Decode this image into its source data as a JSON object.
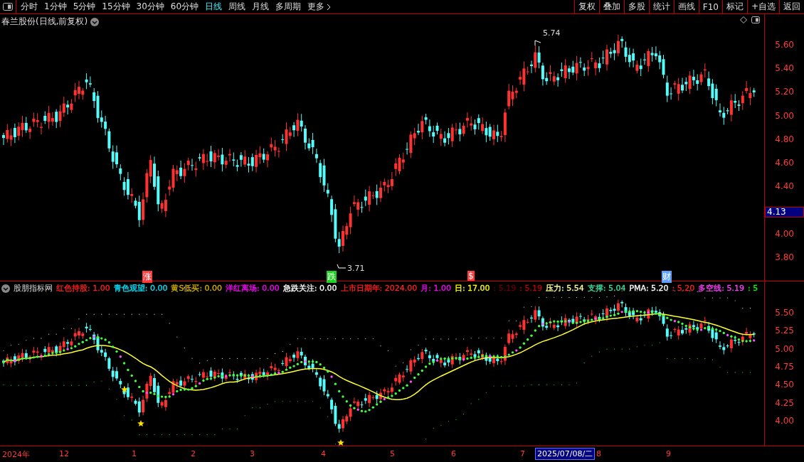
{
  "toolbar": {
    "periods": [
      {
        "label": "分时",
        "selected": false
      },
      {
        "label": "1分钟",
        "selected": false
      },
      {
        "label": "5分钟",
        "selected": false
      },
      {
        "label": "15分钟",
        "selected": false
      },
      {
        "label": "30分钟",
        "selected": false
      },
      {
        "label": "60分钟",
        "selected": false
      },
      {
        "label": "日线",
        "selected": true
      },
      {
        "label": "周线",
        "selected": false
      },
      {
        "label": "月线",
        "selected": false
      },
      {
        "label": "多周期",
        "selected": false
      },
      {
        "label": "更多",
        "selected": false
      }
    ],
    "actions": [
      "复权",
      "叠加",
      "多股",
      "统计",
      "画线",
      "F10",
      "标记",
      "+自选",
      "返回"
    ]
  },
  "main_chart": {
    "title": "春兰股份(日线,前复权)",
    "high_label": "5.74",
    "low_label": "3.71",
    "markers": [
      {
        "text": "涨",
        "color": "#ff3c3c"
      },
      {
        "text": "跌",
        "color": "#20d020"
      },
      {
        "text": "$",
        "color": "#ff3c3c"
      },
      {
        "text": "财",
        "color": "#60a0ff"
      }
    ],
    "price_ticks": [
      "5.60",
      "5.40",
      "5.20",
      "5.00",
      "4.80",
      "4.60",
      "4.40",
      "4.00",
      "3.80"
    ],
    "current_price": "4.13"
  },
  "indicator": {
    "name": "股朋指标网",
    "legend": [
      {
        "text": "红色持股: 1.00",
        "color": "#ff2020"
      },
      {
        "text": "青色观望: 0.00",
        "color": "#00e5ff"
      },
      {
        "text": "黄S低买: 0.00",
        "color": "#d4b000"
      },
      {
        "text": "洋红离场: 0.00",
        "color": "#ff00ff"
      },
      {
        "text": "急跌关注: 0.00",
        "color": "#ffffff"
      },
      {
        "text": "上市日期年: 2024.00",
        "color": "#ff2020"
      },
      {
        "text": "月: 1.00",
        "color": "#ff00ff"
      },
      {
        "text": "日: 17.00",
        "color": "#ffff00"
      },
      {
        "text": ": 5.19",
        "color": "#6a0000"
      },
      {
        "text": ": 5.19",
        "color": "#c00000"
      },
      {
        "text": "压力: 5.54",
        "color": "#ffffa0"
      },
      {
        "text": "支撑: 5.04",
        "color": "#40e0a0"
      },
      {
        "text": "PMA: 5.20",
        "color": "#ffffff"
      },
      {
        "text": ": 5.20",
        "color": "#ff2020"
      },
      {
        "text": "多空线: 5.19",
        "color": "#ff40ff"
      },
      {
        "text": ": 5",
        "color": "#00ff00"
      }
    ],
    "ticks": [
      "5.50",
      "5.25",
      "5.00",
      "4.75",
      "4.50",
      "4.25",
      "4.00"
    ]
  },
  "time_axis": {
    "labels": [
      {
        "text": "2024年",
        "kind": "tick"
      },
      {
        "text": "12",
        "kind": "tick"
      },
      {
        "text": "1",
        "kind": "tick"
      },
      {
        "text": "2",
        "kind": "tick"
      },
      {
        "text": "3",
        "kind": "tick"
      },
      {
        "text": "4",
        "kind": "tick"
      },
      {
        "text": "5",
        "kind": "tick"
      },
      {
        "text": "6",
        "kind": "tick"
      },
      {
        "text": "7",
        "kind": "tick"
      },
      {
        "text": "2025/07/08/二",
        "kind": "cursor"
      },
      {
        "text": "8",
        "kind": "tick"
      },
      {
        "text": "9",
        "kind": "tick"
      }
    ]
  }
}
